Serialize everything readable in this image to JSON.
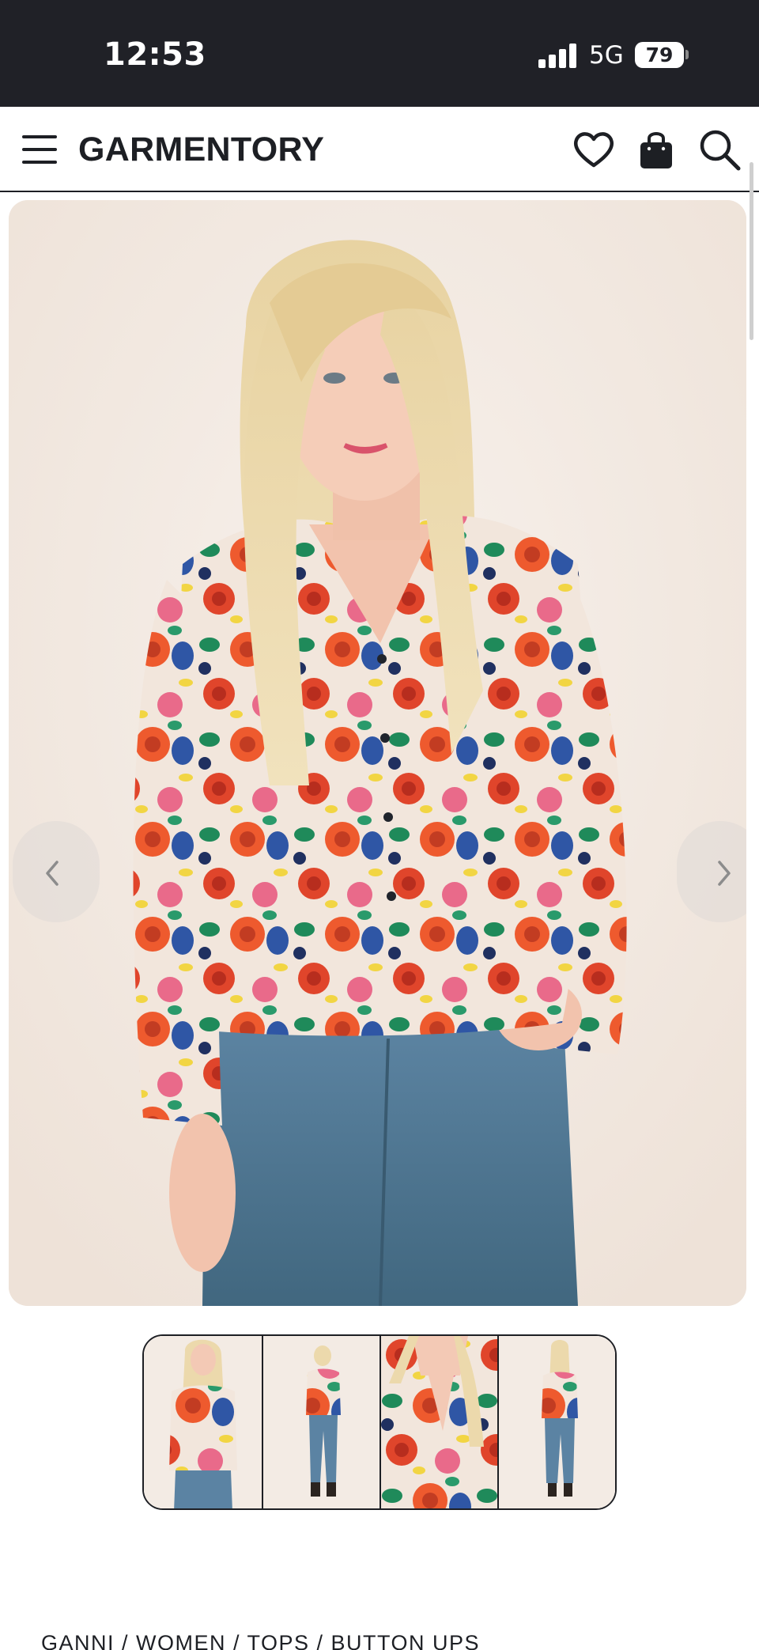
{
  "status_bar": {
    "time": "12:53",
    "network": "5G",
    "battery": "79"
  },
  "header": {
    "brand": "GARMENTORY",
    "icons": [
      "menu-icon",
      "heart-icon",
      "shopping-bag-icon",
      "search-icon"
    ]
  },
  "gallery": {
    "thumbnail_count": 4,
    "selected_index": 0,
    "colors": {
      "accent": "#1d1f24",
      "status_bar": "#202127",
      "backdrop": "#f4ece5"
    }
  },
  "breadcrumb": {
    "text": "GANNI / WOMEN / TOPS / BUTTON UPS"
  }
}
